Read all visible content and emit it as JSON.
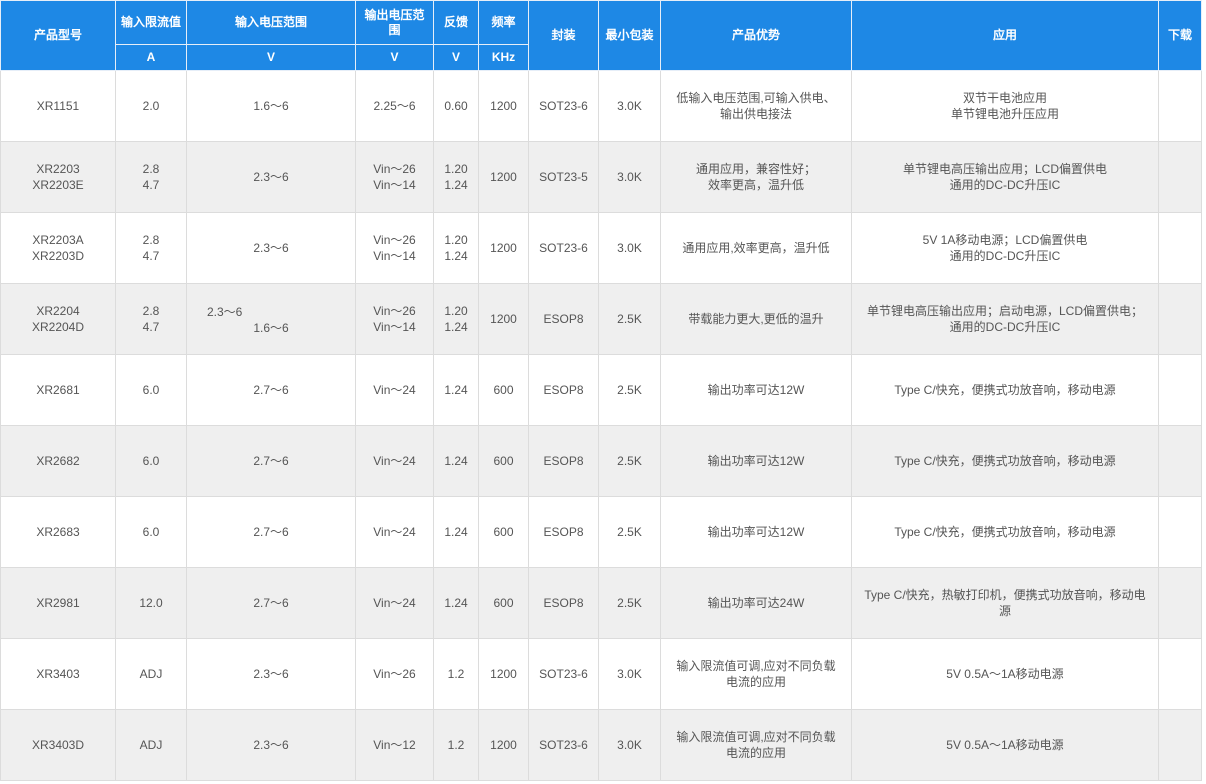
{
  "headers": {
    "model": "产品型号",
    "current_limit": "输入限流值",
    "current_unit": "A",
    "vin_range": "输入电压范围",
    "vin_unit": "V",
    "vout_range": "输出电压范围",
    "vout_unit": "V",
    "feedback": "反馈",
    "feedback_unit": "V",
    "frequency": "频率",
    "frequency_unit": "KHz",
    "package": "封装",
    "min_pack": "最小包装",
    "advantage": "产品优势",
    "application": "应用",
    "download": "下载"
  },
  "rows": [
    {
      "model": "XR1151",
      "current": "2.0",
      "vin": "1.6～6",
      "vout": "2.25～6",
      "fb": "0.60",
      "freq": "1200",
      "pkg": "SOT23-6",
      "min": "3.0K",
      "adv": "低输入电压范围,可输入供电、输出供电接法",
      "app": "双节干电池应用\n单节锂电池升压应用"
    },
    {
      "model": "XR2203\nXR2203E",
      "current": "2.8\n4.7",
      "vin": "2.3～6",
      "vout": "Vin～26\nVin～14",
      "fb": "1.20\n1.24",
      "freq": "1200",
      "pkg": "SOT23-5",
      "min": "3.0K",
      "adv": "通用应用，兼容性好；\n效率更高，温升低",
      "app": "单节锂电高压输出应用；LCD偏置供电\n通用的DC-DC升压IC"
    },
    {
      "model": "XR2203A\nXR2203D",
      "current": "2.8\n4.7",
      "vin": "2.3～6",
      "vout": "Vin～26\nVin～14",
      "fb": "1.20\n1.24",
      "freq": "1200",
      "pkg": "SOT23-6",
      "min": "3.0K",
      "adv": "通用应用,效率更高，温升低",
      "app": "5V 1A移动电源；LCD偏置供电\n通用的DC-DC升压IC"
    },
    {
      "model": "XR2204\nXR2204D",
      "current": "2.8\n4.7",
      "vin_a": "2.3～6",
      "vin_b": "1.6～6",
      "vout": "Vin～26\nVin～14",
      "fb": "1.20\n1.24",
      "freq": "1200",
      "pkg": "ESOP8",
      "min": "2.5K",
      "adv": "带载能力更大,更低的温升",
      "app": "单节锂电高压输出应用；启动电源，LCD偏置供电；\n通用的DC-DC升压IC"
    },
    {
      "model": "XR2681",
      "current": "6.0",
      "vin": "2.7～6",
      "vout": "Vin～24",
      "fb": "1.24",
      "freq": "600",
      "pkg": "ESOP8",
      "min": "2.5K",
      "adv": "输出功率可达12W",
      "app": "Type C/快充，便携式功放音响，移动电源"
    },
    {
      "model": "XR2682",
      "current": "6.0",
      "vin": "2.7～6",
      "vout": "Vin～24",
      "fb": "1.24",
      "freq": "600",
      "pkg": "ESOP8",
      "min": "2.5K",
      "adv": "输出功率可达12W",
      "app": "Type C/快充，便携式功放音响，移动电源"
    },
    {
      "model": "XR2683",
      "current": "6.0",
      "vin": "2.7～6",
      "vout": "Vin～24",
      "fb": "1.24",
      "freq": "600",
      "pkg": "ESOP8",
      "min": "2.5K",
      "adv": "输出功率可达12W",
      "app": "Type C/快充，便携式功放音响，移动电源"
    },
    {
      "model": "XR2981",
      "current": "12.0",
      "vin": "2.7～6",
      "vout": "Vin～24",
      "fb": "1.24",
      "freq": "600",
      "pkg": "ESOP8",
      "min": "2.5K",
      "adv": "输出功率可达24W",
      "app": "Type C/快充，热敏打印机，便携式功放音响，移动电源"
    },
    {
      "model": "XR3403",
      "current": "ADJ",
      "vin": "2.3～6",
      "vout": "Vin～26",
      "fb": "1.2",
      "freq": "1200",
      "pkg": "SOT23-6",
      "min": "3.0K",
      "adv": "输入限流值可调,应对不同负载电流的应用",
      "app": "5V 0.5A～1A移动电源"
    },
    {
      "model": "XR3403D",
      "current": "ADJ",
      "vin": "2.3～6",
      "vout": "Vin～12",
      "fb": "1.2",
      "freq": "1200",
      "pkg": "SOT23-6",
      "min": "3.0K",
      "adv": "输入限流值可调,应对不同负载电流的应用",
      "app": "5V 0.5A～1A移动电源"
    }
  ]
}
